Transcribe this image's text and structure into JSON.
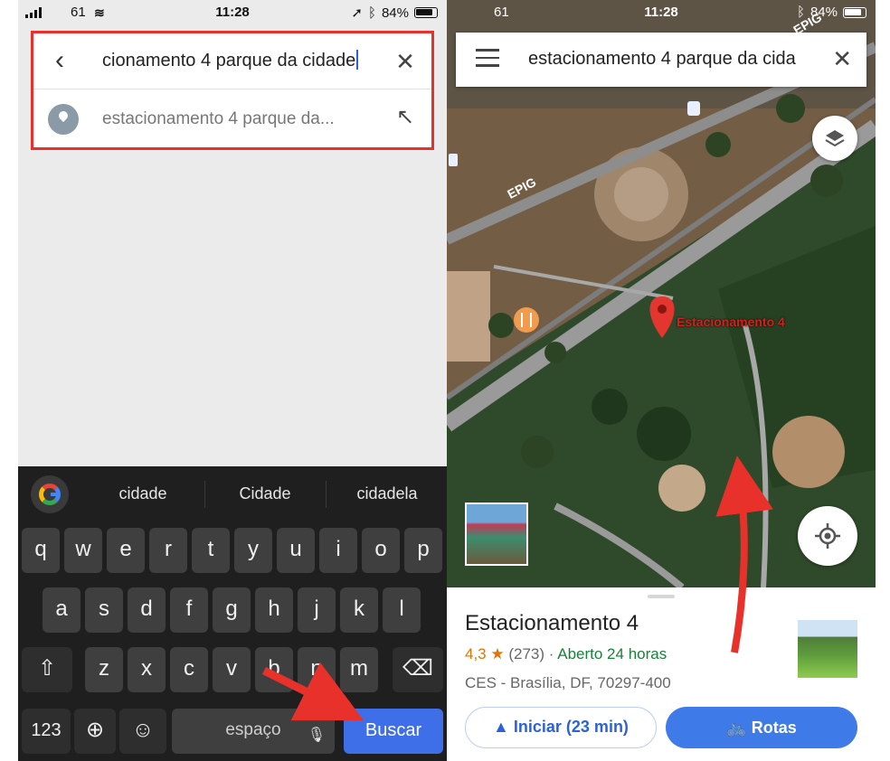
{
  "left": {
    "status": {
      "carrier": "61",
      "time": "11:28",
      "battery": "84%"
    },
    "search": {
      "query": "cionamento 4 parque da cidade",
      "back_icon": "chevron-left-icon",
      "clear_icon": "close-icon"
    },
    "suggestion": {
      "text": "estacionamento 4 parque da...",
      "icon": "place-pin-icon",
      "fill_icon": "arrow-up-left-icon"
    },
    "keyboard": {
      "suggestions": [
        "cidade",
        "Cidade",
        "cidadela"
      ],
      "row1": [
        "q",
        "w",
        "e",
        "r",
        "t",
        "y",
        "u",
        "i",
        "o",
        "p"
      ],
      "row2": [
        "a",
        "s",
        "d",
        "f",
        "g",
        "h",
        "j",
        "k",
        "l"
      ],
      "row3": [
        "z",
        "x",
        "c",
        "v",
        "b",
        "n",
        "m"
      ],
      "numbers_key": "123",
      "space_key": "espaço",
      "search_key": "Buscar"
    }
  },
  "right": {
    "status": {
      "carrier": "61",
      "time": "11:28",
      "battery": "84%"
    },
    "search": {
      "query": "estacionamento 4 parque da cida"
    },
    "map": {
      "marker_label": "Estacionamento 4",
      "road_label_1": "EPIG",
      "road_label_2": "EPIG"
    },
    "place": {
      "title": "Estacionamento 4",
      "rating": "4,3",
      "star": "★",
      "reviews": "(273)",
      "separator": "·",
      "open_status": "Aberto 24 horas",
      "address": "CES - Brasília, DF, 70297-400",
      "start_button": "Iniciar (23 min)",
      "routes_button": "Rotas"
    }
  },
  "colors": {
    "highlight_box": "#e8312a",
    "annotation_arrow": "#e8312a",
    "accent_blue": "#3f7be8",
    "rating_orange": "#e37400",
    "open_green": "#188038"
  }
}
